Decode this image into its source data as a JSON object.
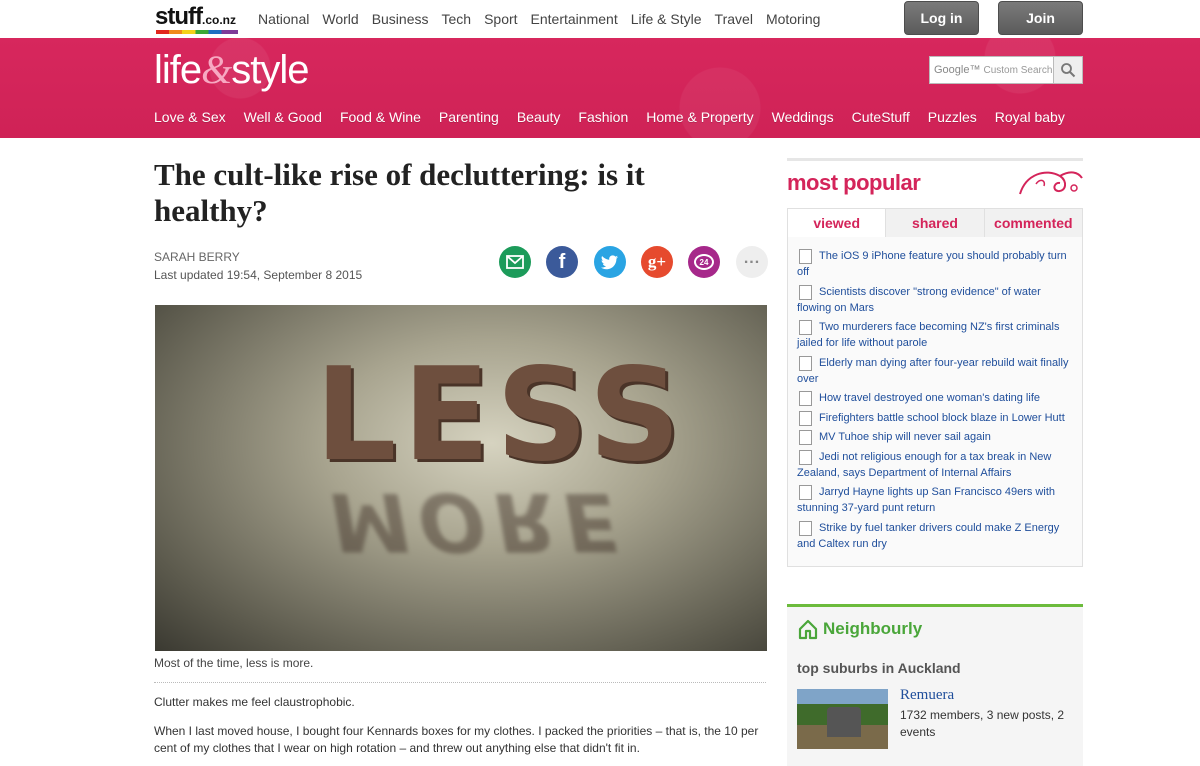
{
  "site": {
    "logo_word": "stuff",
    "logo_tld": ".co.nz"
  },
  "top_nav": [
    "National",
    "World",
    "Business",
    "Tech",
    "Sport",
    "Entertainment",
    "Life & Style",
    "Travel",
    "Motoring"
  ],
  "auth": {
    "login": "Log in",
    "join": "Join"
  },
  "section": {
    "title_part1": "life",
    "title_amp": "&",
    "title_part2": "style"
  },
  "search": {
    "brand": "Google™",
    "placeholder": "Custom Search"
  },
  "sub_nav": [
    "Love & Sex",
    "Well & Good",
    "Food & Wine",
    "Parenting",
    "Beauty",
    "Fashion",
    "Home & Property",
    "Weddings",
    "CuteStuff",
    "Puzzles",
    "Royal baby"
  ],
  "article": {
    "headline": "The cult-like rise of decluttering: is it healthy?",
    "author": "SARAH BERRY",
    "updated": "Last updated 19:54, September 8 2015",
    "image_word": "LESS",
    "image_reflection": "MORE",
    "caption": "Most of the time, less is more.",
    "para1": "Clutter makes me feel claustrophobic.",
    "para2": "When I last moved house, I bought four Kennards boxes for my clothes. I packed the priorities – that is, the 10 per cent of my clothes that I wear on high rotation – and threw out anything else that didn't fit in."
  },
  "share": {
    "comments_count": "24",
    "more": "..."
  },
  "most_popular": {
    "title": "most popular",
    "tabs": [
      "viewed",
      "shared",
      "commented"
    ],
    "items": [
      "The iOS 9 iPhone feature you should probably turn off",
      "Scientists discover \"strong evidence\" of water flowing on Mars",
      "Two murderers face becoming NZ's first criminals jailed for life without parole",
      "Elderly man dying after four-year rebuild wait finally over",
      "How travel destroyed one woman's dating life",
      "Firefighters battle school block blaze in Lower Hutt",
      "MV Tuhoe ship will never sail again",
      "Jedi not religious enough for a tax break in New Zealand, says Department of Internal Affairs",
      "Jarryd Hayne lights up San Francisco 49ers with stunning 37-yard punt return",
      "Strike by fuel tanker drivers could make Z Energy and Caltex run dry"
    ]
  },
  "neighbourly": {
    "brand": "Neighbourly",
    "subtitle": "top suburbs in Auckland",
    "place": "Remuera",
    "stats": "1732 members, 3 new posts, 2 events"
  },
  "colors": {
    "brand_pink": "#d4245a",
    "link_blue": "#1f4e9b",
    "neighbourly_green": "#4aa63a"
  }
}
